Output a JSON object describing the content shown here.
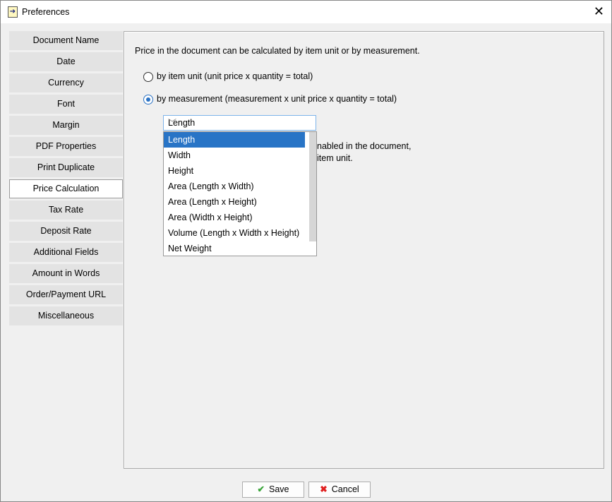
{
  "window": {
    "title": "Preferences",
    "close": "✕"
  },
  "sidebar": {
    "items": [
      "Document Name",
      "Date",
      "Currency",
      "Font",
      "Margin",
      "PDF Properties",
      "Print Duplicate",
      "Price Calculation",
      "Tax Rate",
      "Deposit Rate",
      "Additional Fields",
      "Amount in Words",
      "Order/Payment URL",
      "Miscellaneous"
    ],
    "selected": "Price Calculation"
  },
  "panel": {
    "intro": "Price in the document can be calculated by item unit or by measurement.",
    "option_unit": "by item unit (unit price x quantity = total)",
    "option_measure": "by measurement (measurement x unit price x quantity = total)",
    "selected_option": "by measurement",
    "combo_value": "Length",
    "options": [
      "Length",
      "Width",
      "Height",
      "Area (Length x Width)",
      "Area (Length x Height)",
      "Area (Width x Height)",
      "Volume (Length x Width x Height)",
      "Net Weight"
    ],
    "hidden_line1": "nabled in the document,",
    "hidden_line2": "item unit."
  },
  "buttons": {
    "save": "Save",
    "cancel": "Cancel"
  },
  "colors": {
    "accent": "#2874c6",
    "save_icon": "#3aa53a",
    "cancel_icon": "#e02020"
  }
}
